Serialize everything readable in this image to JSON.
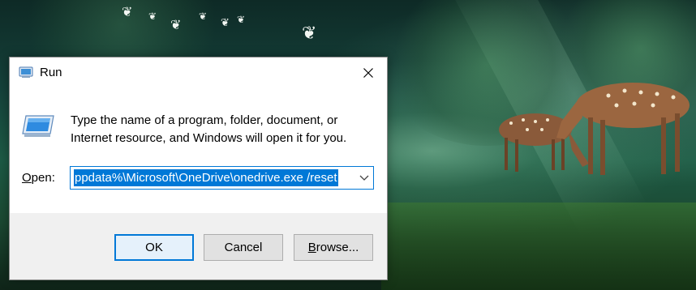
{
  "dialog": {
    "title": "Run",
    "description": "Type the name of a program, folder, document, or Internet resource, and Windows will open it for you.",
    "open_label_underlined": "O",
    "open_label_rest": "pen:",
    "open_value": "ppdata%\\Microsoft\\OneDrive\\onedrive.exe /reset",
    "ok_label": "OK",
    "cancel_label": "Cancel",
    "browse_underlined": "B",
    "browse_rest": "rowse...",
    "icons": {
      "title": "run-icon",
      "body": "run-icon",
      "close": "close-icon",
      "dropdown": "chevron-down-icon"
    },
    "accent_color": "#0078d7"
  },
  "wallpaper": {
    "description_icons": [
      "butterfly-icon",
      "deer-icon"
    ]
  }
}
